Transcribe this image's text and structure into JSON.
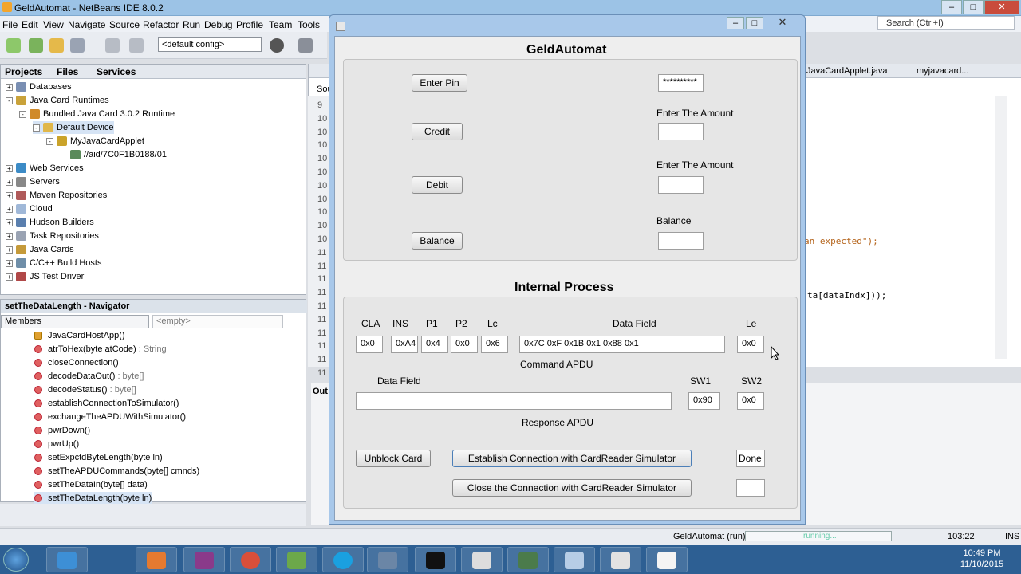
{
  "ide": {
    "title": "GeldAutomat - NetBeans IDE 8.0.2",
    "menu": [
      "File",
      "Edit",
      "View",
      "Navigate",
      "Source",
      "Refactor",
      "Run",
      "Debug",
      "Profile",
      "Team",
      "Tools"
    ],
    "search_placeholder": "Search (Ctrl+I)",
    "config": "<default config>",
    "tabs": [
      "Projects",
      "Files",
      "Services"
    ],
    "services_tree": [
      {
        "label": "Databases",
        "level": 0,
        "expand": "+"
      },
      {
        "label": "Java Card Runtimes",
        "level": 0,
        "expand": "-"
      },
      {
        "label": "Bundled Java Card 3.0.2 Runtime",
        "level": 1,
        "expand": "-"
      },
      {
        "label": "Default Device",
        "level": 2,
        "expand": "-"
      },
      {
        "label": "MyJavaCardApplet",
        "level": 3,
        "expand": "-"
      },
      {
        "label": "//aid/7C0F1B0188/01",
        "level": 4,
        "expand": ""
      },
      {
        "label": "Web Services",
        "level": 0,
        "expand": "+"
      },
      {
        "label": "Servers",
        "level": 0,
        "expand": "+"
      },
      {
        "label": "Maven Repositories",
        "level": 0,
        "expand": "+"
      },
      {
        "label": "Cloud",
        "level": 0,
        "expand": "+"
      },
      {
        "label": "Hudson Builders",
        "level": 0,
        "expand": "+"
      },
      {
        "label": "Task Repositories",
        "level": 0,
        "expand": "+"
      },
      {
        "label": "Java Cards",
        "level": 0,
        "expand": "+"
      },
      {
        "label": "C/C++ Build Hosts",
        "level": 0,
        "expand": "+"
      },
      {
        "label": "JS Test Driver",
        "level": 0,
        "expand": "+"
      }
    ],
    "navigator_title": "setTheDataLength - Navigator",
    "navigator_combo": "Members",
    "navigator_filter": "<empty>",
    "members": [
      {
        "name": "JavaCardHostApp()",
        "type": ""
      },
      {
        "name": "atrToHex(byte atCode)",
        "type": " : String"
      },
      {
        "name": "closeConnection()",
        "type": ""
      },
      {
        "name": "decodeDataOut()",
        "type": " : byte[]"
      },
      {
        "name": "decodeStatus()",
        "type": " : byte[]"
      },
      {
        "name": "establishConnectionToSimulator()",
        "type": ""
      },
      {
        "name": "exchangeTheAPDUWithSimulator()",
        "type": ""
      },
      {
        "name": "pwrDown()",
        "type": ""
      },
      {
        "name": "pwrUp()",
        "type": ""
      },
      {
        "name": "setExpctdByteLength(byte ln)",
        "type": ""
      },
      {
        "name": "setTheAPDUCommands(byte[] cmnds)",
        "type": ""
      },
      {
        "name": "setTheDataIn(byte[] data)",
        "type": ""
      },
      {
        "name": "setTheDataLength(byte ln)",
        "type": ""
      }
    ],
    "editor_tabs": [
      "JavaCardApplet.java",
      "myjavacard..."
    ],
    "editor_source_tab": "Sou",
    "line_numbers": [
      "9",
      "10",
      "10",
      "10",
      "10",
      "10",
      "10",
      "10",
      "10",
      "10",
      "10",
      "11",
      "11",
      "11",
      "11",
      "11",
      "11",
      "11",
      "11",
      "11",
      "11"
    ],
    "code_fragments": [
      "an expected\");",
      "ta[dataIndx]));"
    ],
    "output_tab": "Out",
    "status_run": "GeldAutomat (run)",
    "status_progress": "running...",
    "status_pos": "103:22",
    "status_mode": "INS",
    "clock_time": "10:49 PM",
    "clock_date": "11/10/2015"
  },
  "dialog": {
    "section1_title": "GeldAutomat",
    "enter_pin_button": "Enter Pin",
    "pin_value": "**********",
    "credit_button": "Credit",
    "credit_label": "Enter The Amount",
    "credit_value": "",
    "debit_button": "Debit",
    "debit_label": "Enter The Amount",
    "debit_value": "",
    "balance_button": "Balance",
    "balance_label": "Balance",
    "balance_value": "",
    "section2_title": "Internal Process",
    "cmd_headers": {
      "cla": "CLA",
      "ins": "INS",
      "p1": "P1",
      "p2": "P2",
      "lc": "Lc",
      "data": "Data Field",
      "le": "Le"
    },
    "cmd_values": {
      "cla": "0x0",
      "ins": "0xA4",
      "p1": "0x4",
      "p2": "0x0",
      "lc": "0x6",
      "data": "0x7C 0xF 0x1B 0x1 0x88 0x1",
      "le": "0x0"
    },
    "command_apdu_label": "Command APDU",
    "resp_headers": {
      "data": "Data Field",
      "sw1": "SW1",
      "sw2": "SW2"
    },
    "resp_values": {
      "data": "",
      "sw1": "0x90",
      "sw2": "0x0"
    },
    "response_apdu_label": "Response APDU",
    "unblock_button": "Unblock Card",
    "establish_button": "Establish Connection with CardReader Simulator",
    "establish_status": "Done",
    "close_button": "Close the Connection with CardReader Simulator",
    "close_status": ""
  }
}
